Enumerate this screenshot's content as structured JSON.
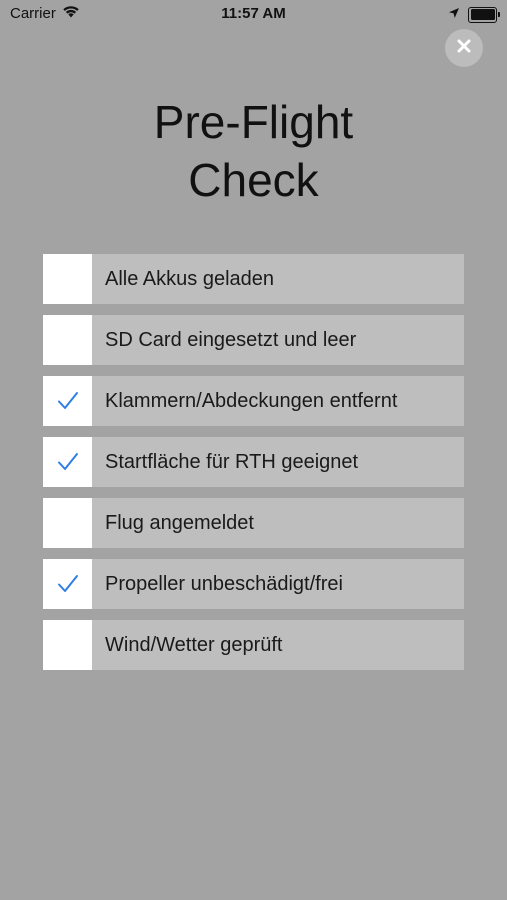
{
  "status_bar": {
    "carrier": "Carrier",
    "time": "11:57 AM"
  },
  "title_lines": [
    "Pre-Flight",
    "Check"
  ],
  "checklist": [
    {
      "label": "Alle Akkus geladen",
      "checked": false
    },
    {
      "label": "SD Card eingesetzt und leer",
      "checked": false
    },
    {
      "label": "Klammern/Abdeckungen entfernt",
      "checked": true
    },
    {
      "label": "Startfläche für RTH geeignet",
      "checked": true
    },
    {
      "label": "Flug angemeldet",
      "checked": false
    },
    {
      "label": "Propeller unbeschädigt/frei",
      "checked": true
    },
    {
      "label": "Wind/Wetter geprüft",
      "checked": false
    }
  ],
  "colors": {
    "background": "#a3a3a3",
    "row_background": "#bebebe",
    "checkbox_background": "#ffffff",
    "checkmark": "#2f7ee6",
    "close_button": "#bcbcbc"
  },
  "icons": {
    "wifi": "wifi-icon",
    "location": "location-arrow-icon",
    "battery": "battery-icon",
    "close": "close-icon",
    "checkmark": "checkmark-icon"
  }
}
